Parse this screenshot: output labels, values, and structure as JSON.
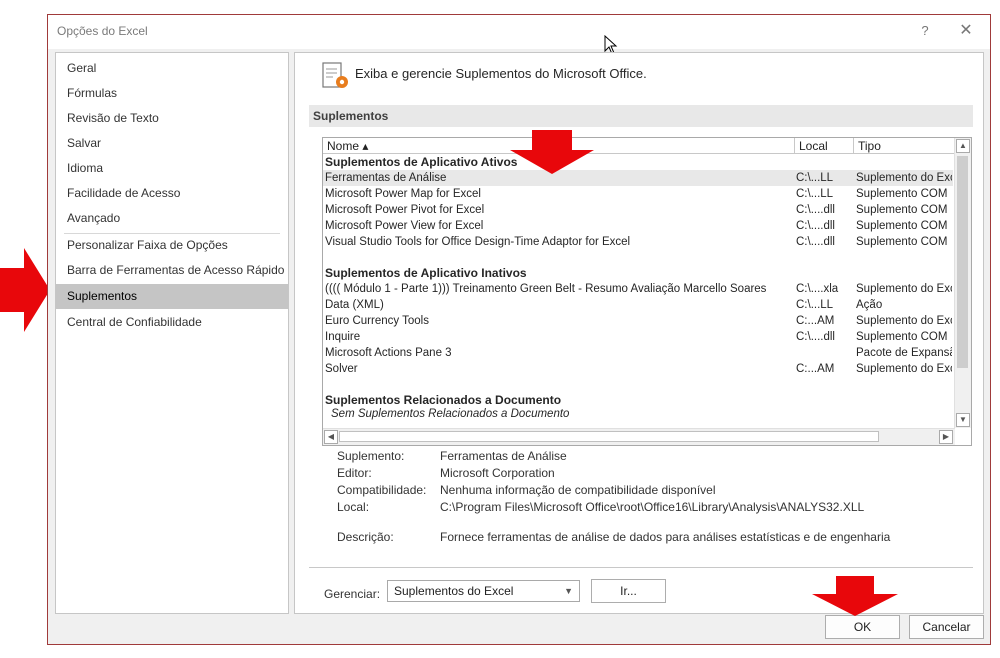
{
  "window": {
    "title": "Opções do Excel",
    "help": "?",
    "close": "✕"
  },
  "colors": {
    "arrow": "#e8070b",
    "selected_nav": "#c5c5c5"
  },
  "nav": {
    "items": [
      {
        "label": "Geral"
      },
      {
        "label": "Fórmulas"
      },
      {
        "label": "Revisão de Texto"
      },
      {
        "label": "Salvar"
      },
      {
        "label": "Idioma"
      },
      {
        "label": "Facilidade de Acesso"
      },
      {
        "label": "Avançado"
      },
      {
        "label": "Personalizar Faixa de Opções"
      },
      {
        "label": "Barra de Ferramentas de Acesso Rápido"
      },
      {
        "label": "Suplementos",
        "selected": true
      },
      {
        "label": "Central de Confiabilidade"
      }
    ]
  },
  "main": {
    "header": "Exiba e gerencie Suplementos do Microsoft Office.",
    "section": "Suplementos",
    "columns": {
      "name": "Nome ▴",
      "local": "Local",
      "tipo": "Tipo"
    },
    "groups": [
      {
        "title": "Suplementos de Aplicativo Ativos",
        "rows": [
          {
            "name": "Ferramentas de Análise",
            "local": "C:\\...LL",
            "tipo": "Suplemento do Excel"
          },
          {
            "name": "Microsoft Power Map for Excel",
            "local": "C:\\...LL",
            "tipo": "Suplemento COM"
          },
          {
            "name": "Microsoft Power Pivot for Excel",
            "local": "C:\\....dll",
            "tipo": "Suplemento COM"
          },
          {
            "name": "Microsoft Power View for Excel",
            "local": "C:\\....dll",
            "tipo": "Suplemento COM"
          },
          {
            "name": "Visual Studio Tools for Office Design-Time Adaptor for Excel",
            "local": "C:\\....dll",
            "tipo": "Suplemento COM"
          }
        ]
      },
      {
        "title": "Suplementos de Aplicativo Inativos",
        "rows": [
          {
            "name": "(((( Módulo 1 - Parte 1)))  Treinamento Green Belt - Resumo Avaliação Marcello Soares",
            "local": "C:\\....xla",
            "tipo": "Suplemento do Excel"
          },
          {
            "name": "Data (XML)",
            "local": "C:\\...LL",
            "tipo": "Ação"
          },
          {
            "name": "Euro Currency Tools",
            "local": "C:...AM",
            "tipo": "Suplemento do Excel"
          },
          {
            "name": "Inquire",
            "local": "C:\\....dll",
            "tipo": "Suplemento COM"
          },
          {
            "name": "Microsoft Actions Pane 3",
            "local": "",
            "tipo": "Pacote de Expansão"
          },
          {
            "name": "Solver",
            "local": "C:...AM",
            "tipo": "Suplemento do Excel"
          }
        ]
      },
      {
        "title": "Suplementos Relacionados a Documento",
        "empty": "Sem Suplementos Relacionados a Documento"
      }
    ],
    "details": {
      "suplemento_label": "Suplemento:",
      "suplemento": "Ferramentas de Análise",
      "editor_label": "Editor:",
      "editor": "Microsoft Corporation",
      "compat_label": "Compatibilidade:",
      "compat": "Nenhuma informação de compatibilidade disponível",
      "local_label": "Local:",
      "local": "C:\\Program Files\\Microsoft Office\\root\\Office16\\Library\\Analysis\\ANALYS32.XLL",
      "desc_label": "Descrição:",
      "desc": "Fornece ferramentas de análise de dados para análises estatísticas e de engenharia"
    },
    "manage": {
      "label": "Gerenciar:",
      "selected": "Suplementos do Excel",
      "go": "Ir..."
    }
  },
  "footer": {
    "ok": "OK",
    "cancel": "Cancelar"
  }
}
